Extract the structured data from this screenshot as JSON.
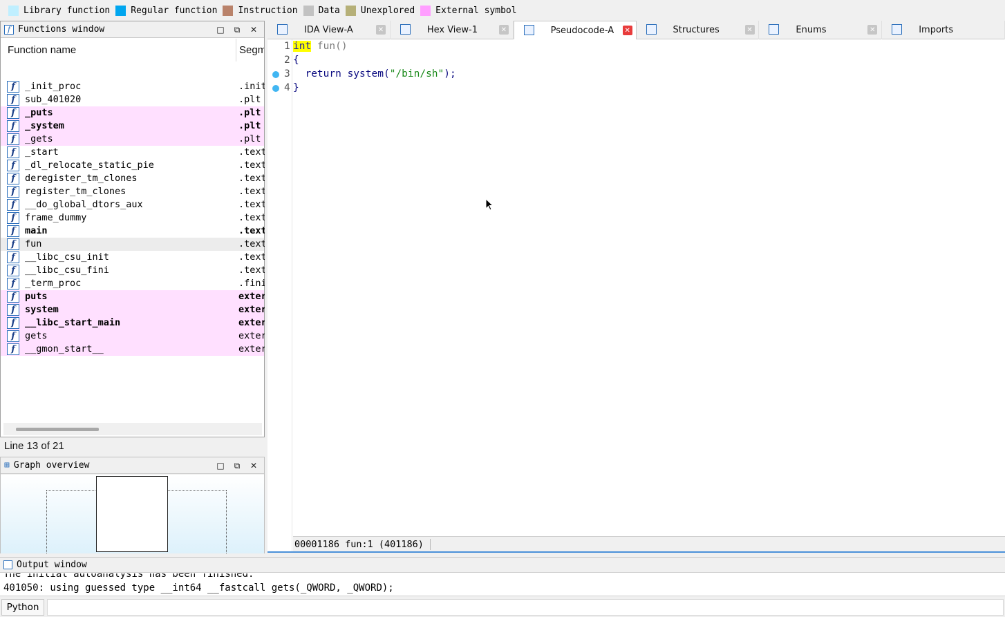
{
  "legend": [
    {
      "label": "Library function",
      "color": "#bfefff"
    },
    {
      "label": "Regular function",
      "color": "#00a6ef"
    },
    {
      "label": "Instruction",
      "color": "#b9826a"
    },
    {
      "label": "Data",
      "color": "#c2c2c2"
    },
    {
      "label": "Unexplored",
      "color": "#b6b078"
    },
    {
      "label": "External symbol",
      "color": "#ff9eff"
    }
  ],
  "functions_window": {
    "title": "Functions window",
    "col_name": "Function name",
    "col_segment": "Segm",
    "rows": [
      {
        "name": "_init_proc",
        "seg": ".init",
        "ext": false,
        "bold": false
      },
      {
        "name": "sub_401020",
        "seg": ".plt",
        "ext": false,
        "bold": false
      },
      {
        "name": "_puts",
        "seg": ".plt",
        "ext": true,
        "bold": true
      },
      {
        "name": "_system",
        "seg": ".plt",
        "ext": true,
        "bold": true
      },
      {
        "name": "_gets",
        "seg": ".plt",
        "ext": true,
        "bold": false
      },
      {
        "name": "_start",
        "seg": ".text",
        "ext": false,
        "bold": false
      },
      {
        "name": "_dl_relocate_static_pie",
        "seg": ".text",
        "ext": false,
        "bold": false
      },
      {
        "name": "deregister_tm_clones",
        "seg": ".text",
        "ext": false,
        "bold": false
      },
      {
        "name": "register_tm_clones",
        "seg": ".text",
        "ext": false,
        "bold": false
      },
      {
        "name": "__do_global_dtors_aux",
        "seg": ".text",
        "ext": false,
        "bold": false
      },
      {
        "name": "frame_dummy",
        "seg": ".text",
        "ext": false,
        "bold": false
      },
      {
        "name": "main",
        "seg": ".text",
        "ext": false,
        "bold": true
      },
      {
        "name": "fun",
        "seg": ".text",
        "ext": false,
        "bold": false,
        "selected": true
      },
      {
        "name": "__libc_csu_init",
        "seg": ".text",
        "ext": false,
        "bold": false
      },
      {
        "name": "__libc_csu_fini",
        "seg": ".text",
        "ext": false,
        "bold": false
      },
      {
        "name": "_term_proc",
        "seg": ".fini",
        "ext": false,
        "bold": false
      },
      {
        "name": "puts",
        "seg": "extern",
        "ext": true,
        "bold": true
      },
      {
        "name": "system",
        "seg": "extern",
        "ext": true,
        "bold": true
      },
      {
        "name": "__libc_start_main",
        "seg": "extern",
        "ext": true,
        "bold": true
      },
      {
        "name": "gets",
        "seg": "extern",
        "ext": true,
        "bold": false
      },
      {
        "name": "__gmon_start__",
        "seg": "extern",
        "ext": true,
        "bold": false
      }
    ],
    "line_count": "Line 13 of 21"
  },
  "graph_overview": {
    "title": "Graph overview"
  },
  "tabs": [
    {
      "label": "IDA View-A",
      "icon": "ida-view-icon",
      "active": false
    },
    {
      "label": "Hex View-1",
      "icon": "hex-view-icon",
      "active": false
    },
    {
      "label": "Pseudocode-A",
      "icon": "pseudocode-icon",
      "active": true
    },
    {
      "label": "Structures",
      "icon": "structures-icon",
      "active": false
    },
    {
      "label": "Enums",
      "icon": "enums-icon",
      "active": false
    },
    {
      "label": "Imports",
      "icon": "imports-icon",
      "active": false
    }
  ],
  "pseudocode": {
    "lines": [
      {
        "num": "1",
        "bp": false
      },
      {
        "num": "2",
        "bp": false
      },
      {
        "num": "3",
        "bp": true
      },
      {
        "num": "4",
        "bp": true
      }
    ],
    "line1_kw": "int",
    "line1_rest": " fun()",
    "line2": "{",
    "line3_a": "  return ",
    "line3_b": "system(",
    "line3_c": "\"/bin/sh\"",
    "line3_d": ");",
    "line4": "}",
    "status": "00001186 fun:1 (401186)"
  },
  "output_window": {
    "title": "Output window",
    "line1": "The initial autoanalysis has been finished.",
    "line2": "401050: using guessed type __int64 __fastcall gets(_QWORD, _QWORD);",
    "cmd_label": "Python"
  }
}
